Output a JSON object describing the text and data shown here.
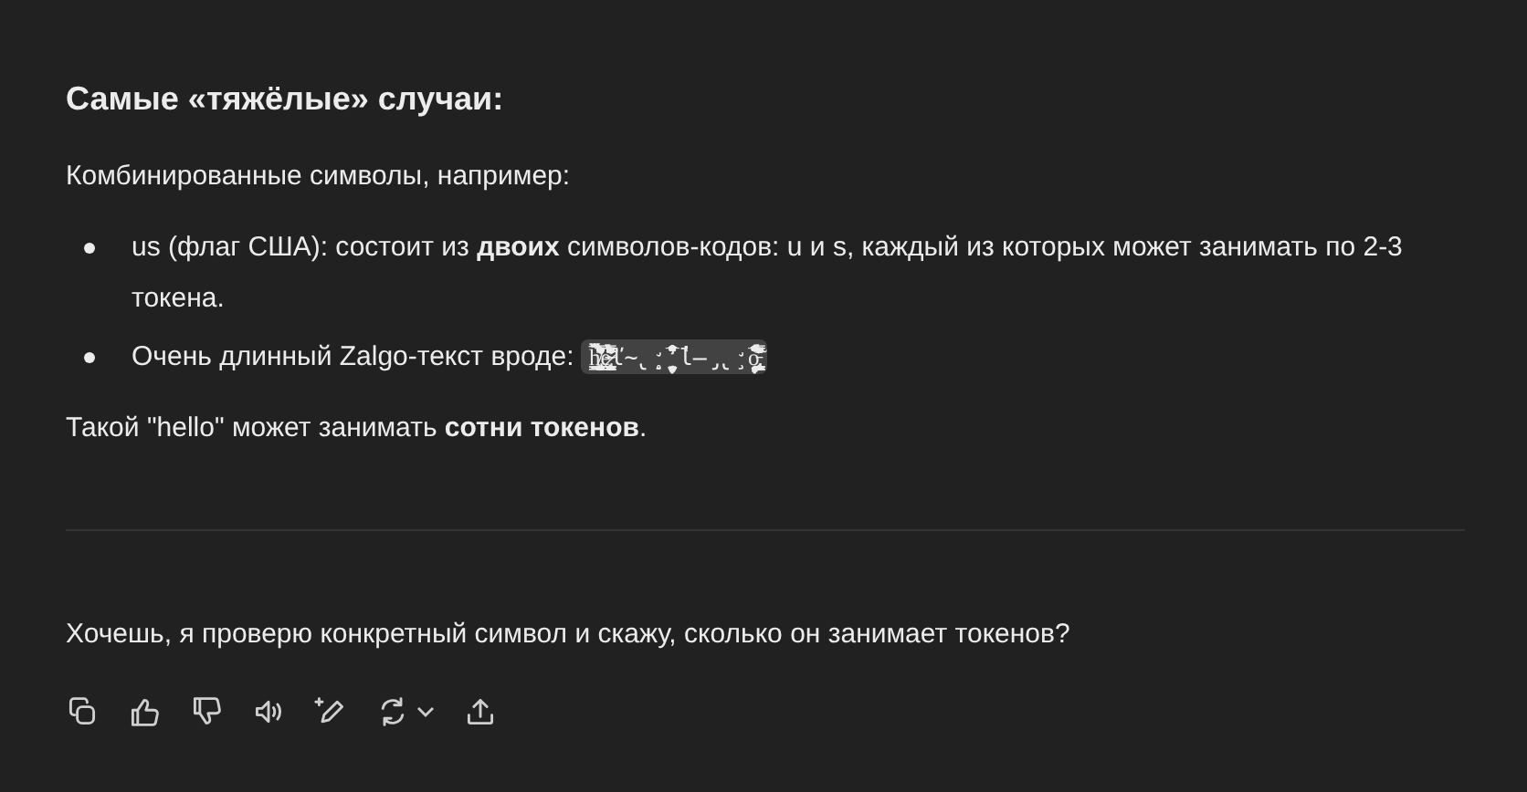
{
  "heading": "Самые «тяжёлые» случаи:",
  "intro": "Комбинированные символы, например:",
  "bullets": [
    {
      "parts": [
        {
          "kind": "text",
          "text": "us (флаг США): состоит из **двоих** символов-кодов: u и s, каждый из которых может занимать по 2-3 токена."
        }
      ]
    },
    {
      "parts": [
        {
          "kind": "text",
          "text": "Очень длинный Zalgo-текст вроде: "
        },
        {
          "kind": "code",
          "text": "h̸̡̛̖̗̘̙̜̝̞̟̠̤̥̦̩̪̫̬̭̮̯̰̱̲̳̹̺̻̼ͅ͏͓͔͕͖͙͚̀́̂̃̄̅̆̇̈̉̊̋̌̍̎̏̐̑̒̓̔̽̾̿̀́͂̓̈́͆͊͋͌ȩ̷̴̵̶̢̧̨̛̖̗̘̙̜̝̞̟̠̣̤̥̦̩̪̫̬̭̮̯̰̱̲̳̹̺̻̼͇͈͉͍͎̀́̂̃̄̅̆̇̈̉̊̋̌̍̎̏̐̑̒̓̔̽̾̿̀́͂̓̈́͆͊͋͌ľ̴̢̧̨̛̖̗̘̙̜̝̞̟̠̣̤̥̦̩̪̫̬̭̀́̂̃̄̅̆̇̈̉̊̋̍̎̏̐̑̒̓̔l̶̡̢̧̛̖̗̘̙̜̝̞̟̠̣̤̥̀́̂̃̄̅̆̇̈̉̊̋̌̍̎̏ò̵̡̢̧̨̖̗̘̙̜̝̞̟̠̣̤̥̦̩̪̫̬̭̮̯̰̱̲̳̹̺̻̼͇͈͉́̂̃̄̅̆̇̈̉̊̋̌̍̎̏̐̑̒̓̔̽̾̿̀́͂̓̈́͆͊"
        }
      ]
    }
  ],
  "outro": "Такой \"hello\" может занимать **сотни токенов**.",
  "question": "Хочешь, я проверю конкретный символ и скажу, сколько он занимает токенов?",
  "actions": [
    {
      "kind": "copy"
    },
    {
      "kind": "like"
    },
    {
      "kind": "dislike"
    },
    {
      "kind": "speak"
    },
    {
      "kind": "edit"
    },
    {
      "kind": "regenerate"
    },
    {
      "kind": "share"
    }
  ]
}
